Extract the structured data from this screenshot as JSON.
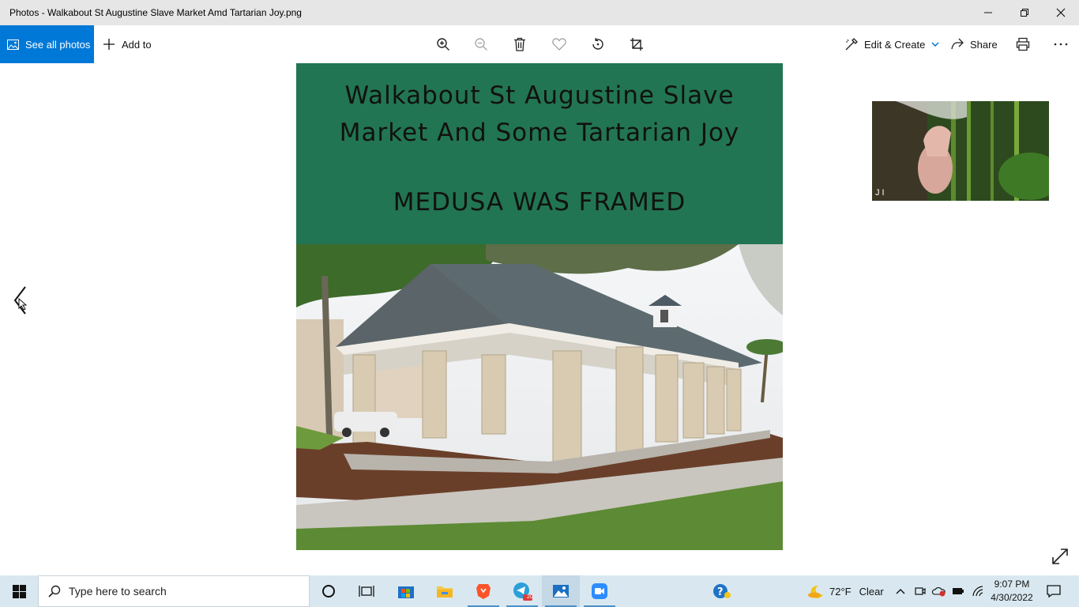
{
  "window": {
    "title": "Photos - Walkabout St Augustine Slave Market Amd Tartarian Joy.png"
  },
  "toolbar": {
    "see_all": "See all photos",
    "add_to": "Add to",
    "icons": [
      "zoom-in-icon",
      "zoom-out-icon",
      "delete-icon",
      "heart-icon",
      "rotate-icon",
      "crop-icon"
    ],
    "edit_create": "Edit & Create",
    "share": "Share"
  },
  "photo": {
    "headline": "Walkabout St Augustine Slave Market And Some Tartarian Joy",
    "subtitle": "MEDUSA WAS FRAMED",
    "banner_color": "#227552"
  },
  "camera": {
    "label": "J I"
  },
  "taskbar": {
    "search_placeholder": "Type here to search",
    "telegram_badge": "20",
    "weather_temp": "72°F",
    "weather_desc": "Clear",
    "time": "9:07 PM",
    "date": "4/30/2022"
  },
  "colors": {
    "accent": "#0078d7",
    "titlebar": "#e6e6e6",
    "taskbar": "#d9e8f0"
  }
}
